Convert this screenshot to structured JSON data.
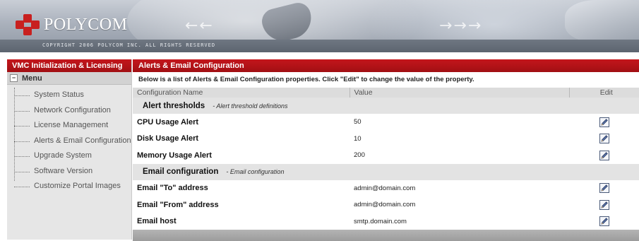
{
  "header": {
    "brand": "POLYCOM",
    "copyright": "COPYRIGHT 2006 POLYCOM INC. ALL RIGHTS RESERVED",
    "accent": "#c4161c"
  },
  "sidebar": {
    "title": "VMC Initialization & Licensing",
    "menu_label": "Menu",
    "menu_toggle": "−",
    "items": [
      {
        "label": "System Status"
      },
      {
        "label": "Network Configuration"
      },
      {
        "label": "License Management"
      },
      {
        "label": "Alerts & Email Configuration"
      },
      {
        "label": "Upgrade System"
      },
      {
        "label": "Software Version"
      },
      {
        "label": "Customize Portal Images"
      }
    ]
  },
  "main": {
    "title": "Alerts & Email Configuration",
    "intro": "Below is a list of Alerts & Email Configuration properties. Click \"Edit\" to change the value of the property.",
    "columns": {
      "name": "Configuration Name",
      "value": "Value",
      "edit": "Edit"
    },
    "sections": [
      {
        "name": "Alert thresholds",
        "description": "- Alert threshold definitions",
        "rows": [
          {
            "name": "CPU Usage Alert",
            "value": "50"
          },
          {
            "name": "Disk Usage Alert",
            "value": "10"
          },
          {
            "name": "Memory Usage Alert",
            "value": "200"
          }
        ]
      },
      {
        "name": "Email configuration",
        "description": "- Email configuration",
        "rows": [
          {
            "name": "Email \"To\" address",
            "value": "admin@domain.com"
          },
          {
            "name": "Email \"From\" address",
            "value": "admin@domain.com"
          },
          {
            "name": "Email host",
            "value": "smtp.domain.com"
          }
        ]
      }
    ],
    "edit_icon": "pencil-icon"
  }
}
